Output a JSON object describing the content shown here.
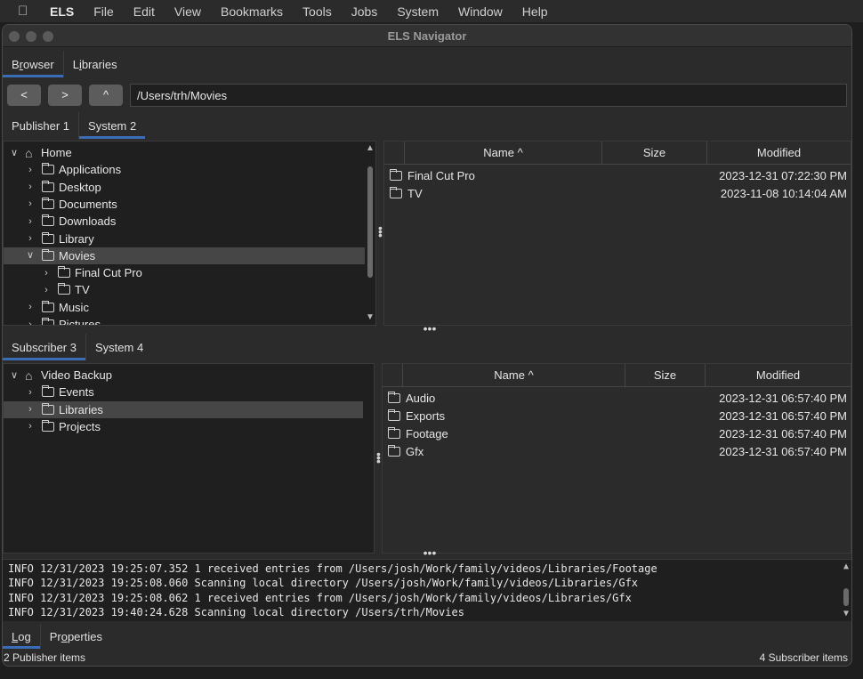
{
  "menubar": {
    "app": "ELS",
    "items": [
      "File",
      "Edit",
      "View",
      "Bookmarks",
      "Tools",
      "Jobs",
      "System",
      "Window",
      "Help"
    ]
  },
  "window": {
    "title": "ELS Navigator"
  },
  "main_tabs": [
    {
      "pre": "B",
      "ul": "r",
      "post": "owser",
      "active": true
    },
    {
      "pre": "L",
      "ul": "i",
      "post": "braries",
      "active": false
    }
  ],
  "nav": {
    "back_label": "<",
    "forward_label": ">",
    "up_label": "^",
    "path": "/Users/trh/Movies"
  },
  "publisher": {
    "tabs": [
      {
        "label": "Publisher 1",
        "active": false
      },
      {
        "label": "System 2",
        "active": true
      }
    ],
    "tree": [
      {
        "label": "Home",
        "icon": "home-icon",
        "expanded": true,
        "depth": 0
      },
      {
        "label": "Applications",
        "depth": 1
      },
      {
        "label": "Desktop",
        "depth": 1
      },
      {
        "label": "Documents",
        "depth": 1
      },
      {
        "label": "Downloads",
        "depth": 1
      },
      {
        "label": "Library",
        "depth": 1
      },
      {
        "label": "Movies",
        "depth": 1,
        "expanded": true,
        "selected": true
      },
      {
        "label": "Final Cut Pro",
        "depth": 2
      },
      {
        "label": "TV",
        "depth": 2
      },
      {
        "label": "Music",
        "depth": 1
      },
      {
        "label": "Pictures",
        "depth": 1
      }
    ],
    "columns": {
      "name": "Name ^",
      "size": "Size",
      "modified": "Modified"
    },
    "rows": [
      {
        "name": "Final Cut Pro",
        "size": "",
        "modified": "2023-12-31 07:22:30 PM"
      },
      {
        "name": "TV",
        "size": "",
        "modified": "2023-11-08 10:14:04 AM"
      }
    ]
  },
  "subscriber": {
    "tabs": [
      {
        "label": "Subscriber 3",
        "active": true
      },
      {
        "label": "System 4",
        "active": false
      }
    ],
    "tree": [
      {
        "label": "Video Backup",
        "icon": "home-icon",
        "expanded": true,
        "depth": 0
      },
      {
        "label": "Events",
        "depth": 1
      },
      {
        "label": "Libraries",
        "depth": 1,
        "selected": true
      },
      {
        "label": "Projects",
        "depth": 1
      }
    ],
    "columns": {
      "name": "Name ^",
      "size": "Size",
      "modified": "Modified"
    },
    "rows": [
      {
        "name": "Audio",
        "size": "",
        "modified": "2023-12-31 06:57:40 PM"
      },
      {
        "name": "Exports",
        "size": "",
        "modified": "2023-12-31 06:57:40 PM"
      },
      {
        "name": "Footage",
        "size": "",
        "modified": "2023-12-31 06:57:40 PM"
      },
      {
        "name": "Gfx",
        "size": "",
        "modified": "2023-12-31 06:57:40 PM"
      }
    ]
  },
  "log": [
    "INFO  12/31/2023 19:25:07.352 1 received entries from /Users/josh/Work/family/videos/Libraries/Footage",
    "INFO  12/31/2023 19:25:08.060 Scanning local directory /Users/josh/Work/family/videos/Libraries/Gfx",
    "INFO  12/31/2023 19:25:08.062 1 received entries from /Users/josh/Work/family/videos/Libraries/Gfx",
    "INFO  12/31/2023 19:40:24.628 Scanning local directory /Users/trh/Movies"
  ],
  "bottom_tabs": [
    {
      "pre": "",
      "ul": "L",
      "post": "og",
      "active": true
    },
    {
      "pre": "Pr",
      "ul": "o",
      "post": "perties",
      "active": false
    }
  ],
  "status": {
    "left": "2 Publisher items",
    "right": "4 Subscriber items"
  }
}
